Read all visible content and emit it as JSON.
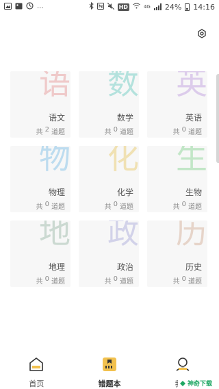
{
  "status_bar": {
    "time": "14:16",
    "battery_percent": "24%",
    "hd_badge": "HD",
    "network_type": "4G",
    "left_more": "..."
  },
  "subjects": [
    {
      "char": "语",
      "name": "语文",
      "count_prefix": "共",
      "count": "2",
      "count_suffix": "道题",
      "color": "#e9a7a7"
    },
    {
      "char": "数",
      "name": "数学",
      "count_prefix": "共",
      "count": "0",
      "count_suffix": "道题",
      "color": "#7fd1c9"
    },
    {
      "char": "英",
      "name": "英语",
      "count_prefix": "共",
      "count": "0",
      "count_suffix": "道题",
      "color": "#c7a9e2"
    },
    {
      "char": "物",
      "name": "物理",
      "count_prefix": "共",
      "count": "0",
      "count_suffix": "道题",
      "color": "#8ec6ea"
    },
    {
      "char": "化",
      "name": "化学",
      "count_prefix": "共",
      "count": "0",
      "count_suffix": "道题",
      "color": "#ecd07c"
    },
    {
      "char": "生",
      "name": "生物",
      "count_prefix": "共",
      "count": "0",
      "count_suffix": "道题",
      "color": "#97d9a0"
    },
    {
      "char": "地",
      "name": "地理",
      "count_prefix": "共",
      "count": "0",
      "count_suffix": "道题",
      "color": "#a8c2b2"
    },
    {
      "char": "政",
      "name": "政治",
      "count_prefix": "共",
      "count": "0",
      "count_suffix": "道题",
      "color": "#b4b4de"
    },
    {
      "char": "历",
      "name": "历史",
      "count_prefix": "共",
      "count": "0",
      "count_suffix": "道题",
      "color": "#d9b8a4"
    }
  ],
  "nav": {
    "home": "首页",
    "wrongbook": "错题本",
    "me": "我的"
  },
  "colors": {
    "accent": "#f2c14e",
    "card_bg": "#f7f7f7"
  },
  "watermark": "神奇下载"
}
